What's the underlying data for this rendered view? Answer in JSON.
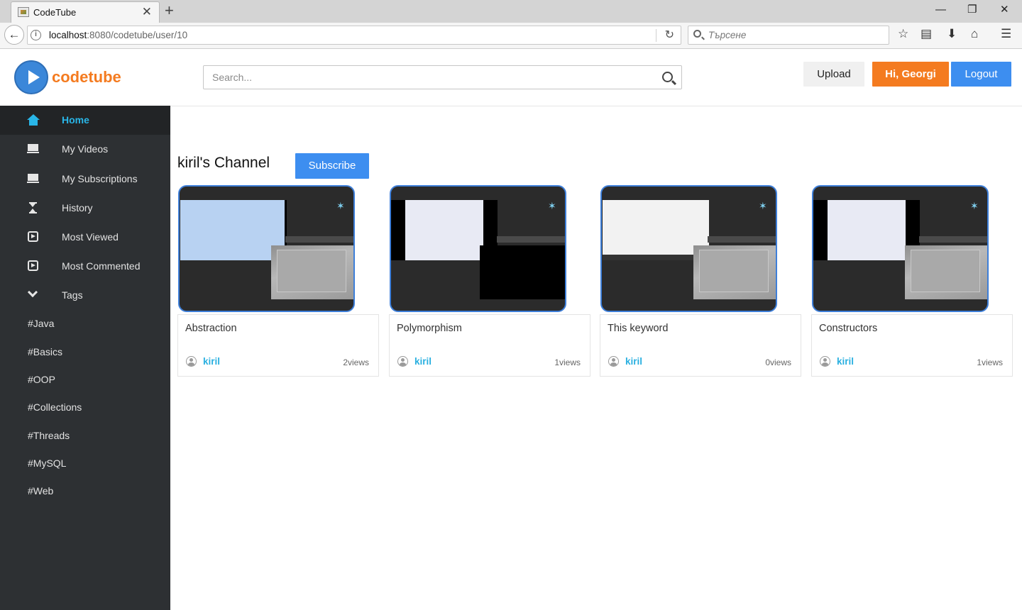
{
  "browser": {
    "tab_title": "CodeTube",
    "url_host": "localhost",
    "url_rest": ":8080/codetube/user/10",
    "search_placeholder": "Търсене"
  },
  "header": {
    "logo_text": "codetube",
    "search_placeholder": "Search...",
    "upload_label": "Upload",
    "greeting_label": "Hi, Georgi",
    "logout_label": "Logout"
  },
  "sidebar": {
    "items": [
      {
        "label": "Home",
        "icon": "home-icon"
      },
      {
        "label": "My Videos",
        "icon": "screen-icon"
      },
      {
        "label": "My Subscriptions",
        "icon": "screen-icon"
      },
      {
        "label": "History",
        "icon": "hourglass-icon"
      },
      {
        "label": "Most Viewed",
        "icon": "play-icon"
      },
      {
        "label": "Most Commented",
        "icon": "play-icon"
      },
      {
        "label": "Tags",
        "icon": "chevron-down-icon"
      }
    ],
    "tags": [
      "#Java",
      "#Basics",
      "#OOP",
      "#Collections",
      "#Threads",
      "#MySQL",
      "#Web"
    ]
  },
  "main": {
    "channel_title": "kiril's Channel",
    "subscribe_label": "Subscribe",
    "videos": [
      {
        "title": "Abstraction",
        "author": "kiril",
        "views": "2views"
      },
      {
        "title": "Polymorphism",
        "author": "kiril",
        "views": "1views"
      },
      {
        "title": "This keyword",
        "author": "kiril",
        "views": "0views"
      },
      {
        "title": "Constructors",
        "author": "kiril",
        "views": "1views"
      }
    ]
  },
  "colors": {
    "brand_orange": "#f47b20",
    "brand_blue": "#3d8ef0",
    "sidebar_bg": "#2d3033",
    "active_link": "#29b6e8"
  }
}
